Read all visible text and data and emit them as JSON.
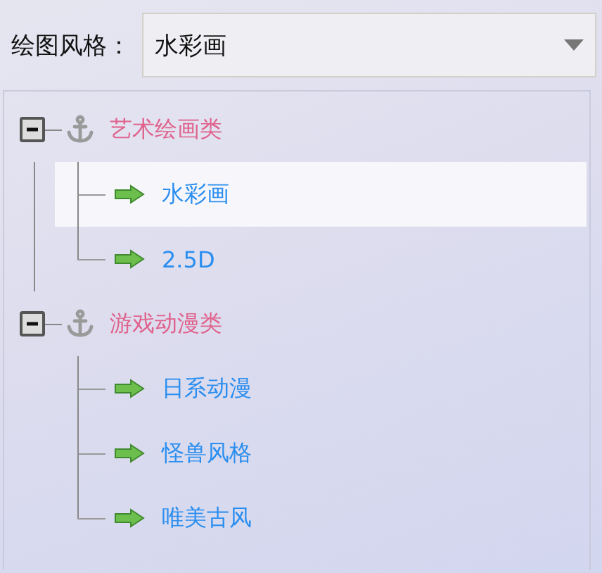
{
  "style_field": {
    "label": "绘图风格：",
    "value": "水彩画"
  },
  "tree": [
    {
      "label": "艺术绘画类",
      "expanded": true,
      "children": [
        {
          "label": "水彩画",
          "selected": true
        },
        {
          "label": "2.5D",
          "selected": false
        }
      ]
    },
    {
      "label": "游戏动漫类",
      "expanded": true,
      "children": [
        {
          "label": "日系动漫",
          "selected": false
        },
        {
          "label": "怪兽风格",
          "selected": false
        },
        {
          "label": "唯美古风",
          "selected": false
        }
      ]
    }
  ]
}
